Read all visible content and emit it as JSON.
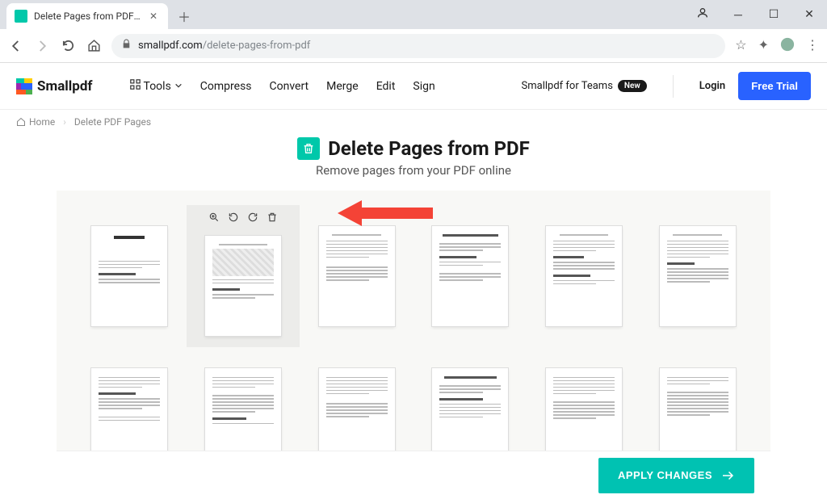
{
  "browser": {
    "tab_title": "Delete Pages from PDF - Remov",
    "url_domain": "smallpdf.com",
    "url_path": "/delete-pages-from-pdf"
  },
  "header": {
    "logo": "Smallpdf",
    "nav": {
      "tools": "Tools",
      "compress": "Compress",
      "convert": "Convert",
      "merge": "Merge",
      "edit": "Edit",
      "sign": "Sign"
    },
    "teams": "Smallpdf for Teams",
    "teams_badge": "New",
    "login": "Login",
    "free_trial": "Free Trial"
  },
  "breadcrumb": {
    "home": "Home",
    "current": "Delete PDF Pages"
  },
  "title": {
    "heading": "Delete Pages from PDF",
    "subtitle": "Remove pages from your PDF online"
  },
  "apply_button": "APPLY CHANGES",
  "colors": {
    "primary_blue": "#2962ff",
    "primary_teal": "#00c2b2",
    "arrow_red": "#f44336"
  }
}
